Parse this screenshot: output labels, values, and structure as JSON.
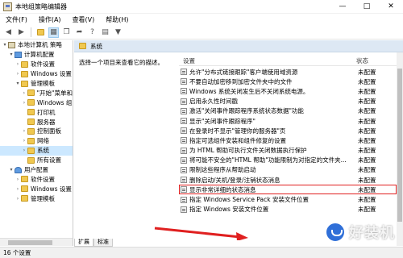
{
  "window": {
    "title": "本地组策略编辑器",
    "controls": [
      "—",
      "□",
      "✕"
    ]
  },
  "menu": [
    "文件(F)",
    "操作(A)",
    "查看(V)",
    "帮助(H)"
  ],
  "toolbar_icons": [
    "back-arrow-icon",
    "forward-arrow-icon",
    "folder-up-icon",
    "show-hide-tree-icon",
    "copy-icon",
    "export-list-icon",
    "help-icon",
    "properties-icon",
    "filter-icon"
  ],
  "tree": [
    {
      "label": "本地计算机 策略",
      "level": 0,
      "icon": "root",
      "exp": "▾"
    },
    {
      "label": "计算机配置",
      "level": 1,
      "icon": "pc",
      "exp": "▾"
    },
    {
      "label": "软件设置",
      "level": 2,
      "icon": "folder",
      "exp": "›"
    },
    {
      "label": "Windows 设置",
      "level": 2,
      "icon": "folder",
      "exp": "›"
    },
    {
      "label": "管理模板",
      "level": 2,
      "icon": "folder",
      "exp": "▾"
    },
    {
      "label": "\"开始\"菜单和",
      "level": 3,
      "icon": "folder",
      "exp": "›"
    },
    {
      "label": "Windows 组",
      "level": 3,
      "icon": "folder",
      "exp": "›"
    },
    {
      "label": "打印机",
      "level": 3,
      "icon": "folder",
      "exp": ""
    },
    {
      "label": "服务器",
      "level": 3,
      "icon": "folder",
      "exp": ""
    },
    {
      "label": "控制面板",
      "level": 3,
      "icon": "folder",
      "exp": "›"
    },
    {
      "label": "网络",
      "level": 3,
      "icon": "folder",
      "exp": "›"
    },
    {
      "label": "系统",
      "level": 3,
      "icon": "folder",
      "exp": "›",
      "selected": true
    },
    {
      "label": "所有设置",
      "level": 3,
      "icon": "folder",
      "exp": ""
    },
    {
      "label": "用户配置",
      "level": 1,
      "icon": "user",
      "exp": "▾"
    },
    {
      "label": "软件设置",
      "level": 2,
      "icon": "folder",
      "exp": "›"
    },
    {
      "label": "Windows 设置",
      "level": 2,
      "icon": "folder",
      "exp": "›"
    },
    {
      "label": "管理模板",
      "level": 2,
      "icon": "folder",
      "exp": "›"
    }
  ],
  "pane": {
    "header_title": "系统",
    "description": "选择一个项目来查看它的描述。",
    "col_setting": "设置",
    "col_state": "状态"
  },
  "settings": [
    {
      "name": "允许\"分布式链接跟踪\"客户端使用域资源",
      "state": "未配置"
    },
    {
      "name": "不要自动加密移到加密文件夹中的文件",
      "state": "未配置"
    },
    {
      "name": "Windows 系统关闭发生后不关闭系统电源。",
      "state": "未配置"
    },
    {
      "name": "启用永久性时间戳",
      "state": "未配置"
    },
    {
      "name": "激活\"关闭事件跟踪程序系统状态数据\"功能",
      "state": "未配置"
    },
    {
      "name": "显示\"关闭事件跟踪程序\"",
      "state": "未配置"
    },
    {
      "name": "在登录时不显示\"管理你的服务器\"页",
      "state": "未配置"
    },
    {
      "name": "指定可选组件安装和组件修复的设置",
      "state": "未配置"
    },
    {
      "name": "为 HTML 帮助可执行文件关闭数据执行保护",
      "state": "未配置"
    },
    {
      "name": "将可能不安全的\"HTML 帮助\"功能限制为对指定的文件夹...",
      "state": "未配置"
    },
    {
      "name": "限制这些程序从帮助启动",
      "state": "未配置"
    },
    {
      "name": "删除启动/关机/登录/注销状态消息",
      "state": "未配置"
    },
    {
      "name": "显示非常详细的状态消息",
      "state": "未配置",
      "highlighted": true
    },
    {
      "name": "指定 Windows Service Pack 安装文件位置",
      "state": "未配置"
    },
    {
      "name": "指定 Windows 安装文件位置",
      "state": "未配置"
    }
  ],
  "tabs": {
    "extended": "扩展",
    "standard": "标准"
  },
  "status": "16 个设置",
  "watermark": "好装机",
  "colors": {
    "highlight_box": "#e02020",
    "selected_tree": "#cce8ff",
    "pane_header": "#dde8f4"
  }
}
